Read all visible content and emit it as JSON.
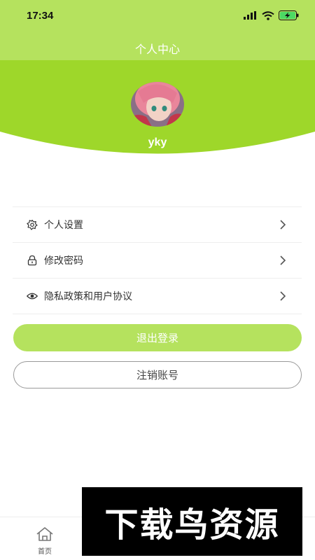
{
  "status_bar": {
    "time": "17:34"
  },
  "header": {
    "title": "个人中心"
  },
  "profile": {
    "username": "yky"
  },
  "menu": {
    "items": [
      {
        "label": "个人设置",
        "icon": "settings-flower-icon"
      },
      {
        "label": "修改密码",
        "icon": "lock-icon"
      },
      {
        "label": "隐私政策和用户协议",
        "icon": "eye-icon"
      }
    ]
  },
  "actions": {
    "logout_label": "退出登录",
    "cancel_account_label": "注销账号"
  },
  "tab_bar": {
    "home_label": "首页"
  },
  "watermark": {
    "text": "下载鸟资源"
  },
  "colors": {
    "accent": "#b5e25e",
    "accent_dark": "#9ed72a"
  }
}
